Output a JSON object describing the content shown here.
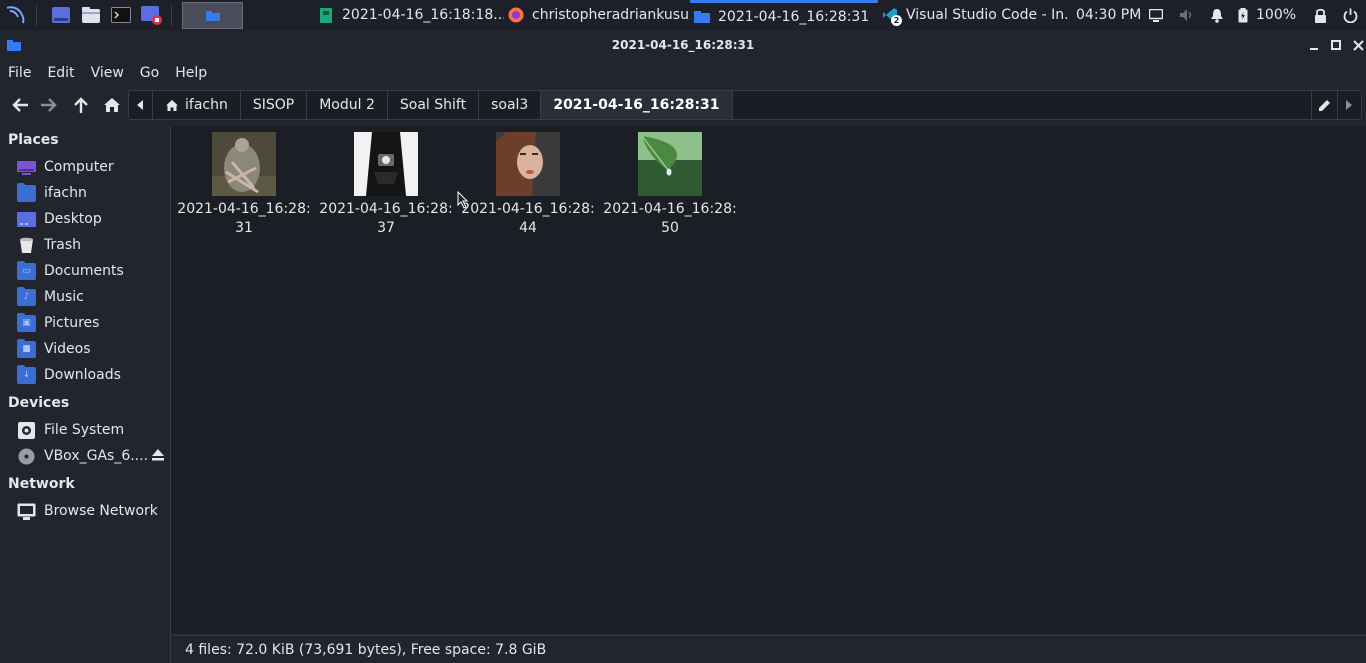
{
  "taskbar": {
    "tasks": [
      {
        "label": "2021-04-16_16:18:18....",
        "icon": "image-viewer-icon"
      },
      {
        "label": "christopheradriankusu...",
        "icon": "firefox-icon"
      },
      {
        "label": "2021-04-16_16:28:31",
        "icon": "folder-icon"
      },
      {
        "label": "Visual Studio Code - In...",
        "icon": "vscode-icon",
        "badge": "2"
      }
    ],
    "clock": "04:30 PM",
    "battery": "100%"
  },
  "window": {
    "title": "2021-04-16_16:28:31"
  },
  "menu": [
    "File",
    "Edit",
    "View",
    "Go",
    "Help"
  ],
  "pathbar": {
    "crumbs": [
      "ifachn",
      "SISOP",
      "Modul 2",
      "Soal Shift",
      "soal3",
      "2021-04-16_16:28:31"
    ]
  },
  "sidebar": {
    "places_heading": "Places",
    "places": [
      "Computer",
      "ifachn",
      "Desktop",
      "Trash",
      "Documents",
      "Music",
      "Pictures",
      "Videos",
      "Downloads"
    ],
    "devices_heading": "Devices",
    "devices": [
      "File System",
      "VBox_GAs_6...."
    ],
    "network_heading": "Network",
    "network": [
      "Browse Network"
    ]
  },
  "files": [
    {
      "name": "2021-04-16_16:28:31"
    },
    {
      "name": "2021-04-16_16:28:37"
    },
    {
      "name": "2021-04-16_16:28:44"
    },
    {
      "name": "2021-04-16_16:28:50"
    }
  ],
  "status": "4 files: 72.0 KiB (73,691 bytes), Free space: 7.8 GiB",
  "colors": {
    "accent": "#367bf0",
    "folder": "#3b6ed4",
    "background": "#1c1e26",
    "panel": "#23252e"
  }
}
